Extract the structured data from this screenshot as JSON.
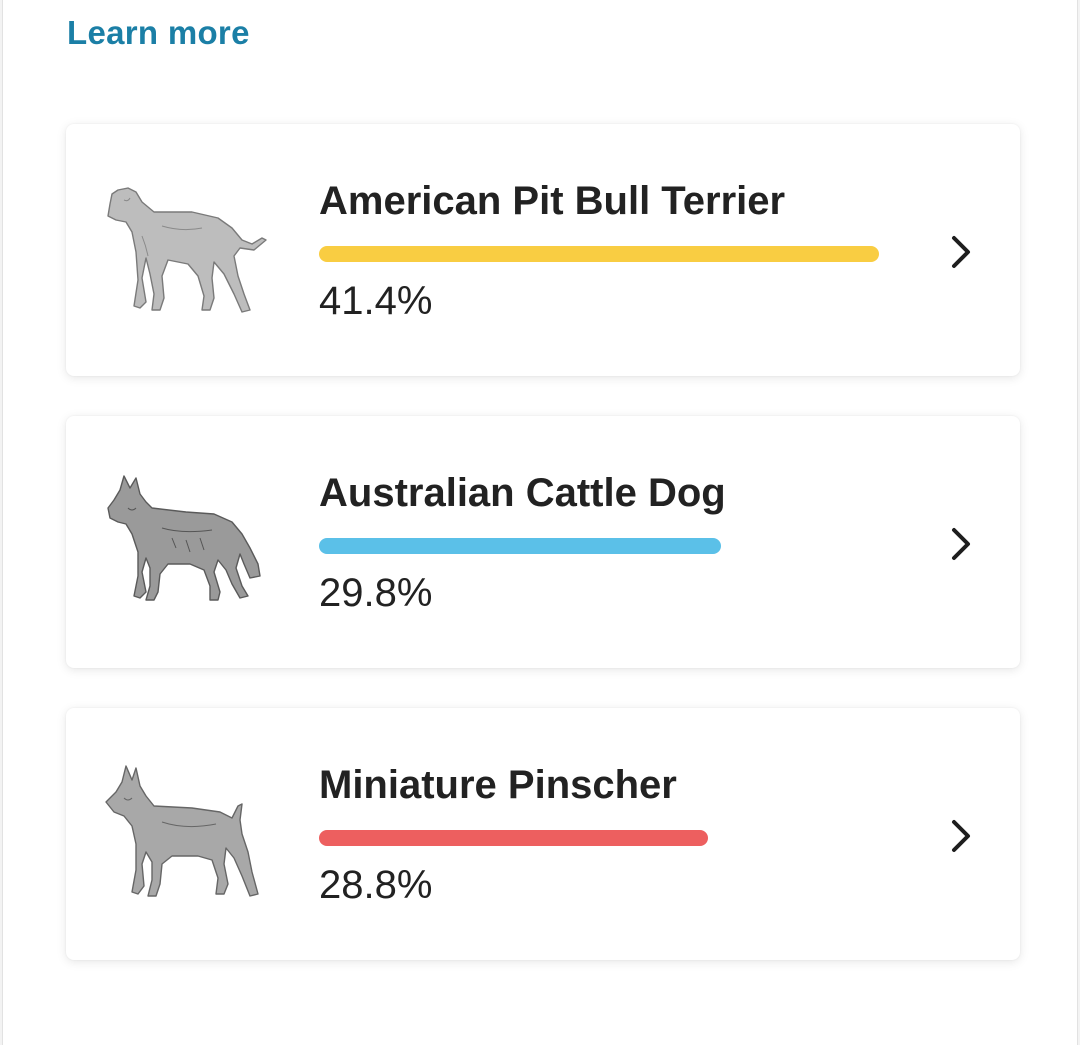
{
  "header": {
    "learn_more": "Learn more"
  },
  "breeds": [
    {
      "name": "American Pit Bull Terrier",
      "percent_label": "41.4%",
      "percent": 41.4,
      "bar_fraction": 0.874,
      "color": "#f9cd42",
      "icon": "pit-bull-dog-icon"
    },
    {
      "name": "Australian Cattle Dog",
      "percent_label": "29.8%",
      "percent": 29.8,
      "bar_fraction": 0.629,
      "color": "#5bc0e8",
      "icon": "cattle-dog-icon"
    },
    {
      "name": "Miniature Pinscher",
      "percent_label": "28.8%",
      "percent": 28.8,
      "bar_fraction": 0.608,
      "color": "#ed5f5f",
      "icon": "miniature-pinscher-dog-icon"
    }
  ],
  "chevron_icon": "chevron-right-icon"
}
